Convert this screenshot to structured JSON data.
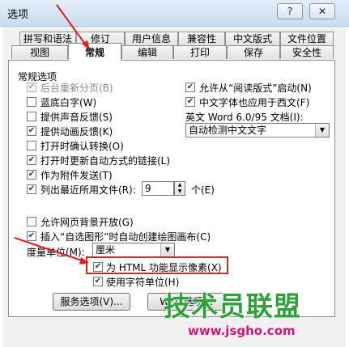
{
  "window": {
    "title": "选项",
    "help_label": "?",
    "close_label": "✕"
  },
  "tabs_row1": [
    "拼写和语法",
    "修订",
    "用户信息",
    "兼容性",
    "中文版式",
    "文件位置"
  ],
  "tabs_row2": [
    "视图",
    "常规",
    "编辑",
    "打印",
    "保存",
    "安全性"
  ],
  "general": {
    "section_title": "常规选项",
    "left_checks": [
      {
        "label": "后台重新分页(B)",
        "checked": true,
        "disabled": true
      },
      {
        "label": "蓝底白字(W)",
        "checked": false,
        "disabled": false
      },
      {
        "label": "提供声音反馈(S)",
        "checked": false,
        "disabled": false
      },
      {
        "label": "提供动画反馈(K)",
        "checked": true,
        "disabled": false
      },
      {
        "label": "打开时确认转换(O)",
        "checked": false,
        "disabled": false
      },
      {
        "label": "打开时更新自动方式的链接(L)",
        "checked": true,
        "disabled": false
      },
      {
        "label": "作为附件发送(T)",
        "checked": true,
        "disabled": false
      },
      {
        "label": "列出最近所用文件(R):",
        "checked": true,
        "disabled": false
      }
    ],
    "right_checks": [
      {
        "label": "允许从“阅读版式”启动(N)",
        "checked": true
      },
      {
        "label": "中文字体也应用于西文(F)",
        "checked": true
      }
    ],
    "word_doc_label": "英文 Word 6.0/95 文档(I):",
    "word_doc_value": "自动检测中文文字",
    "recent_files_count": "9",
    "recent_files_unit": "个(E)",
    "lower_checks": [
      {
        "label": "允许网页背景开放(G)",
        "checked": false
      },
      {
        "label": "插入“自选图形”时自动创建绘图画布(C)",
        "checked": true
      }
    ],
    "unit_label": "度量单位(M):",
    "unit_value": "厘米",
    "html_pixels": {
      "label": "为 HTML 功能显示像素(X)",
      "checked": true
    },
    "char_units": {
      "label": "使用字符单位(H)",
      "checked": true
    }
  },
  "buttons": {
    "service_options": "服务选项(V)...",
    "web_options": "Web 选项..."
  },
  "watermark": {
    "brand": "技术员联盟",
    "url": "www.jsgho.com"
  },
  "colors": {
    "highlight_red": "#e02020",
    "watermark_green": "#2fa13a",
    "watermark_magenta": "#d0157f"
  }
}
